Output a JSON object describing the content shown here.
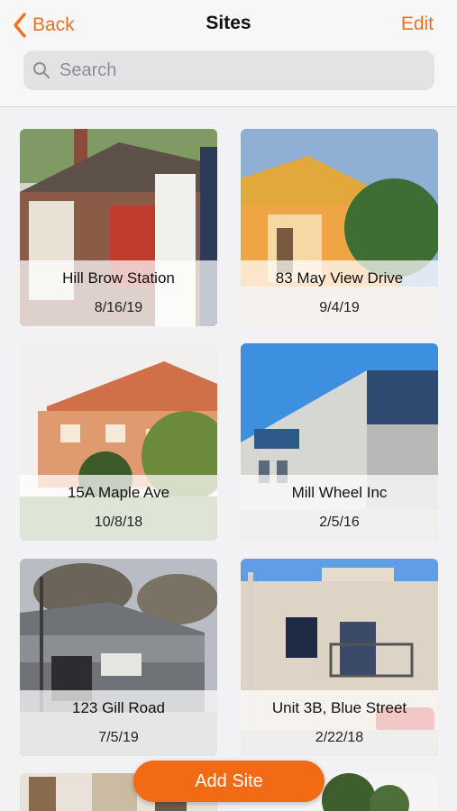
{
  "nav": {
    "back_label": "Back",
    "title": "Sites",
    "edit_label": "Edit"
  },
  "search": {
    "placeholder": "Search",
    "value": ""
  },
  "sites": [
    {
      "name": "Hill Brow Station",
      "date": "8/16/19"
    },
    {
      "name": "83 May View Drive",
      "date": "9/4/19"
    },
    {
      "name": "15A Maple Ave",
      "date": "10/8/18"
    },
    {
      "name": "Mill Wheel Inc",
      "date": "2/5/16"
    },
    {
      "name": "123 Gill Road",
      "date": "7/5/19"
    },
    {
      "name": "Unit 3B, Blue Street",
      "date": "2/22/18"
    }
  ],
  "add_site_label": "Add Site",
  "colors": {
    "accent": "#f0711e",
    "button": "#f26a14"
  }
}
